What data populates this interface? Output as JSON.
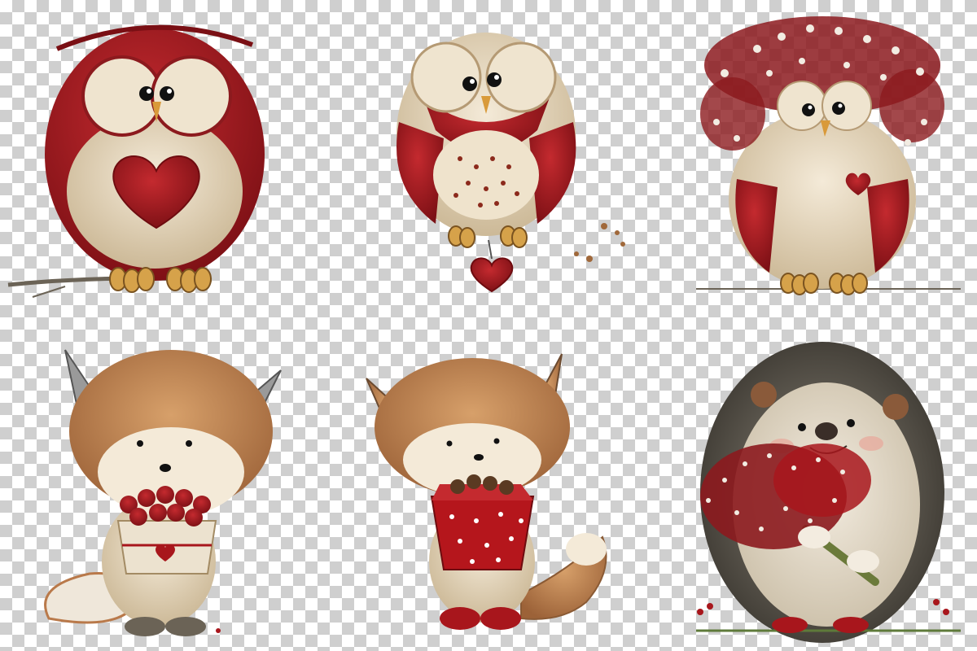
{
  "image": {
    "background": "transparency-checkerboard",
    "checker_colors": [
      "#ffffff",
      "#cfcfcf"
    ],
    "palette": {
      "red": "#a8161c",
      "dark_red": "#7a0f14",
      "cream": "#e9dcc4",
      "tan": "#c08a52",
      "fox_orange": "#b9794a",
      "brown": "#5a3a22",
      "grey_fur": "#9a9a9a"
    },
    "illustrations": [
      {
        "name": "owl-heart-branch",
        "icon": "owl-icon"
      },
      {
        "name": "owl-hanging-heart",
        "icon": "owl-icon"
      },
      {
        "name": "owl-flower-crown",
        "icon": "owl-icon"
      },
      {
        "name": "fox-cherries-box",
        "icon": "fox-icon"
      },
      {
        "name": "fox-chocolate-box",
        "icon": "fox-icon"
      },
      {
        "name": "hedgehog-bouquet",
        "icon": "hedgehog-icon"
      }
    ]
  }
}
